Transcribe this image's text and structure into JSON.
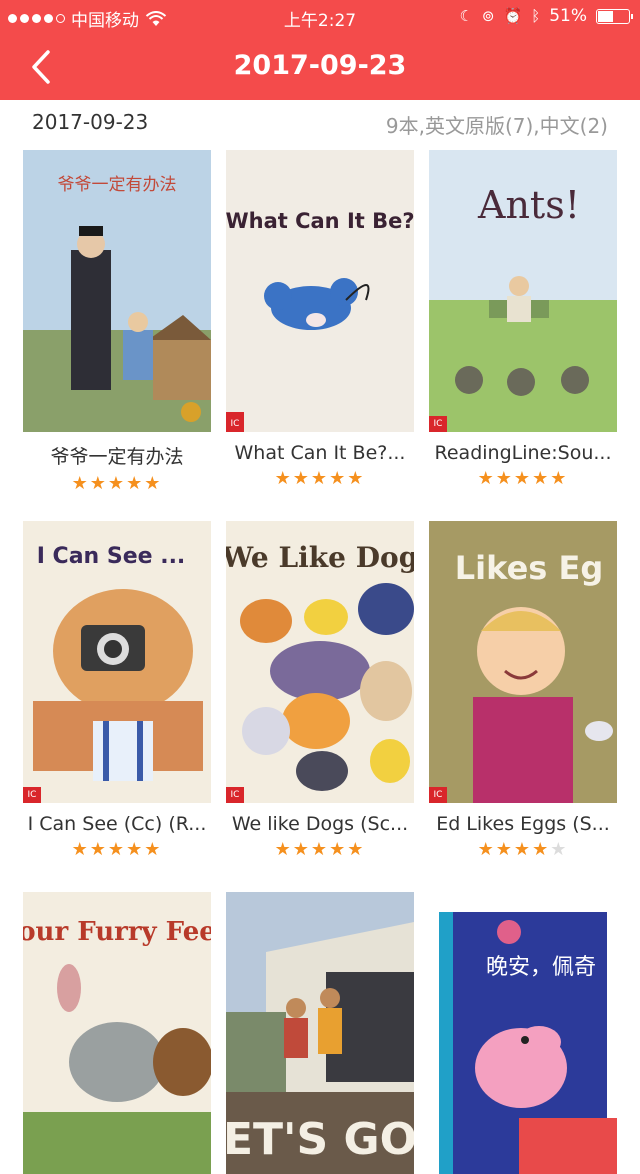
{
  "status_bar": {
    "carrier": "中国移动",
    "time": "上午2:27",
    "battery": "51%",
    "battery_level": 0.51,
    "signal_bars_filled": 4,
    "signal_bars_total": 5
  },
  "nav": {
    "title": "2017-09-23"
  },
  "summary": {
    "date": "2017-09-23",
    "counts": "9本,英文原版(7),中文(2)"
  },
  "colors": {
    "accent": "#f44b4b",
    "star_on": "#f5901e",
    "star_off": "#dcdcdc"
  },
  "books": [
    {
      "title": "爷爷一定有办法",
      "rating": 5,
      "cover_text": "爷爷一定有办法"
    },
    {
      "title": "What Can It Be?...",
      "rating": 5,
      "cover_text": "What Can It Be?",
      "badge": "IC"
    },
    {
      "title": "ReadingLine:Sou...",
      "rating": 5,
      "cover_text": "Ants!",
      "badge": "IC"
    },
    {
      "title": "I Can See (Cc) (R...",
      "rating": 5,
      "cover_text": "I Can See ...",
      "badge": "IC"
    },
    {
      "title": "We like Dogs (Sc...",
      "rating": 5,
      "cover_text": "We Like Dog",
      "badge": "IC"
    },
    {
      "title": "Ed Likes Eggs (S...",
      "rating": 4,
      "cover_text": "Likes Eg",
      "badge": "IC"
    },
    {
      "title": "",
      "rating": 0,
      "cover_text": "our Furry Fee"
    },
    {
      "title": "",
      "rating": 0,
      "cover_text": "ET'S GO"
    },
    {
      "title": "",
      "rating": 0,
      "cover_text": "晚安，佩奇"
    }
  ]
}
